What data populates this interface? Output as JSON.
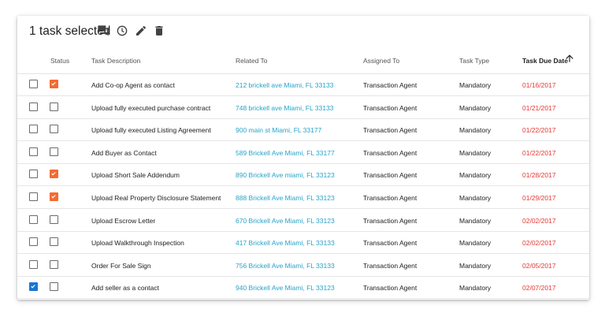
{
  "toolbar": {
    "selection_text": "1 task selected",
    "icons": [
      "comment-icon",
      "clock-icon",
      "edit-icon",
      "delete-icon"
    ]
  },
  "columns": {
    "status": "Status",
    "description": "Task Description",
    "related": "Related To",
    "assigned": "Assigned To",
    "type": "Task Type",
    "due": "Task Due Date"
  },
  "colors": {
    "status_checked": "#f26b32",
    "row_selected": "#1976d2",
    "link": "#26a3c9",
    "due_date": "#e53935"
  },
  "rows": [
    {
      "selected": false,
      "status_done": true,
      "description": "Add Co-op Agent as contact",
      "related": "212 brickell ave Miami, FL 33133",
      "assigned": "Transaction Agent",
      "type": "Mandatory",
      "due": "01/16/2017"
    },
    {
      "selected": false,
      "status_done": false,
      "description": "Upload fully executed purchase contract",
      "related": "748 brickell ave Miami, FL 33133",
      "assigned": "Transaction Agent",
      "type": "Mandatory",
      "due": "01/21/2017"
    },
    {
      "selected": false,
      "status_done": false,
      "description": "Upload fully executed Listing Agreement",
      "related": "900 main st Miami, FL 33177",
      "assigned": "Transaction Agent",
      "type": "Mandatory",
      "due": "01/22/2017"
    },
    {
      "selected": false,
      "status_done": false,
      "description": "Add Buyer as Contact",
      "related": "589 Brickell Ave Miami, FL 33177",
      "assigned": "Transaction Agent",
      "type": "Mandatory",
      "due": "01/22/2017"
    },
    {
      "selected": false,
      "status_done": true,
      "description": "Upload Short Sale Addendum",
      "related": "890 Brickell Ave miami, FL 33123",
      "assigned": "Transaction Agent",
      "type": "Mandatory",
      "due": "01/28/2017"
    },
    {
      "selected": false,
      "status_done": true,
      "description": "Upload Real Property Disclosure Statement",
      "related": "888 Brickell Ave Miami, FL 33123",
      "assigned": "Transaction Agent",
      "type": "Mandatory",
      "due": "01/29/2017"
    },
    {
      "selected": false,
      "status_done": false,
      "description": "Upload Escrow Letter",
      "related": "670 Brickell Ave Miami, FL 33123",
      "assigned": "Transaction Agent",
      "type": "Mandatory",
      "due": "02/02/2017"
    },
    {
      "selected": false,
      "status_done": false,
      "description": "Upload Walkthrough Inspection",
      "related": "417 Brickell Ave Miami, FL 33133",
      "assigned": "Transaction Agent",
      "type": "Mandatory",
      "due": "02/02/2017"
    },
    {
      "selected": false,
      "status_done": false,
      "description": "Order For Sale Sign",
      "related": "756 Brickell Ave Miami, FL 33133",
      "assigned": "Transaction Agent",
      "type": "Mandatory",
      "due": "02/05/2017"
    },
    {
      "selected": true,
      "status_done": false,
      "description": "Add seller as a contact",
      "related": "940 Brickell Ave Miami, FL 33123",
      "assigned": "Transaction Agent",
      "type": "Mandatory",
      "due": "02/07/2017"
    }
  ]
}
